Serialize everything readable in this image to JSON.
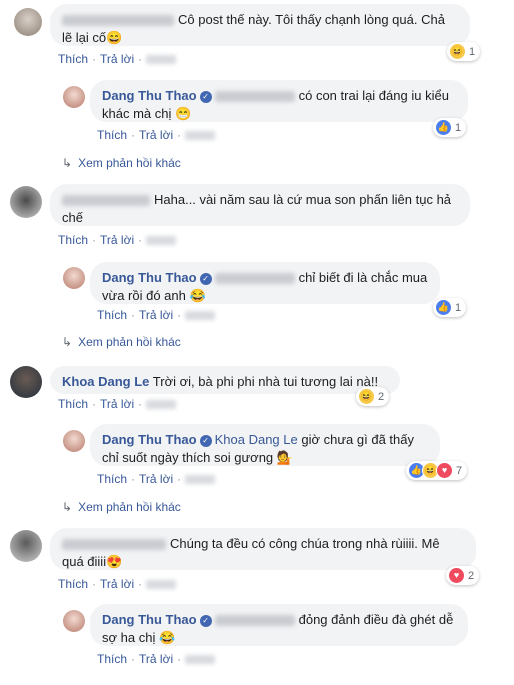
{
  "comments": [
    {
      "text": "Cô post thế này. Tôi thấy chạnh lòng quá. Chả lẽ lại cố😄",
      "like": "Thích",
      "reply": "Trả lời",
      "react_count": "1",
      "replies": [
        {
          "name": "Dang Thu Thao",
          "text": "có con trai lại đáng iu kiểu khác mà chị 😁",
          "like": "Thích",
          "reply": "Trả lời",
          "react_count": "1"
        }
      ],
      "more": "Xem phản hồi khác"
    },
    {
      "text": "Haha... vài năm sau là cứ mua son phấn liên tục hả chế",
      "like": "Thích",
      "reply": "Trả lời",
      "replies": [
        {
          "name": "Dang Thu Thao",
          "text": "chỉ biết đi là chắc mua vừa rồi đó anh 😂",
          "like": "Thích",
          "reply": "Trả lời",
          "react_count": "1"
        }
      ],
      "more": "Xem phản hồi khác"
    },
    {
      "name": "Khoa Dang Le",
      "text": "Trời ơi, bà phi phi nhà tui tương lai nà!!",
      "like": "Thích",
      "reply": "Trả lời",
      "react_count": "2",
      "replies": [
        {
          "name": "Dang Thu Thao",
          "mention": "Khoa Dang Le",
          "text": "giờ chưa gì đã thấy chỉ suốt ngày thích soi gương 💁",
          "like": "Thích",
          "reply": "Trả lời",
          "react_count": "7"
        }
      ],
      "more": "Xem phản hồi khác"
    },
    {
      "text": "Chúng ta đều có công chúa trong nhà rùiiii. Mê quá điiii😍",
      "like": "Thích",
      "reply": "Trả lời",
      "react_count": "2",
      "replies": [
        {
          "name": "Dang Thu Thao",
          "text": "đỏng đảnh điều đà ghét dễ sợ ha chị 😂",
          "like": "Thích",
          "reply": "Trả lời"
        }
      ]
    }
  ],
  "icons": {
    "verified": "verified-check-icon",
    "like": "like-reaction-icon",
    "haha": "haha-reaction-icon",
    "love": "love-reaction-icon",
    "reply_arrow": "reply-arrow-icon"
  },
  "colors": {
    "link": "#385898",
    "bubble": "#f2f3f5",
    "like": "#4a7df0",
    "love": "#f04a5e",
    "haha": "#f7c948"
  }
}
